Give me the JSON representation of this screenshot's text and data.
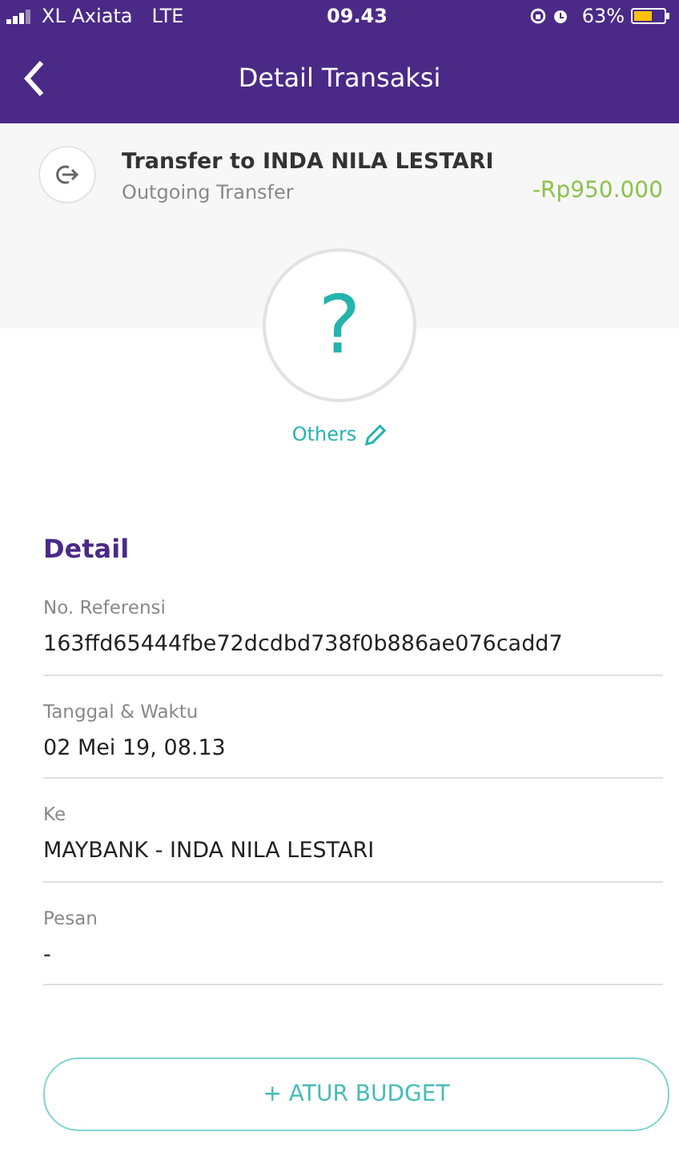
{
  "status_bar": {
    "carrier": "XL Axiata",
    "network": "LTE",
    "time": "09.43",
    "battery": "63%"
  },
  "header": {
    "title": "Detail Transaksi"
  },
  "transaction": {
    "title": "Transfer to INDA NILA LESTARI",
    "subtitle": "Outgoing Transfer",
    "amount": "-Rp950.000"
  },
  "category": {
    "icon": "?",
    "label": "Others"
  },
  "detail": {
    "heading": "Detail",
    "fields": [
      {
        "label": "No. Referensi",
        "value": "163ffd65444fbe72dcdbd738f0b886ae076cadd7"
      },
      {
        "label": "Tanggal & Waktu",
        "value": "02 Mei 19, 08.13"
      },
      {
        "label": "Ke",
        "value": "MAYBANK - INDA NILA LESTARI"
      },
      {
        "label": "Pesan",
        "value": "-"
      }
    ]
  },
  "buttons": [
    "+ ATUR BUDGET"
  ]
}
